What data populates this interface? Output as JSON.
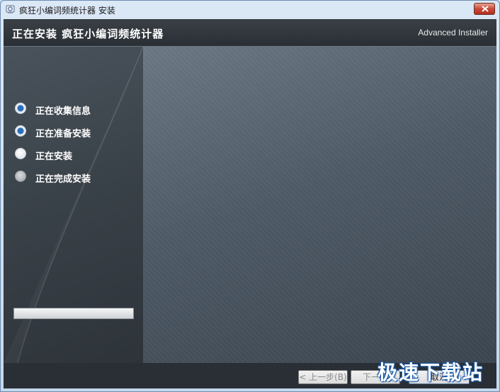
{
  "window": {
    "title": "疯狂小编词频统计器 安装"
  },
  "header": {
    "title": "正在安装 疯狂小编词频统计器",
    "brand": "Advanced Installer"
  },
  "steps": [
    {
      "label": "正在收集信息",
      "state": "done"
    },
    {
      "label": "正在准备安装",
      "state": "done"
    },
    {
      "label": "正在安装",
      "state": "current"
    },
    {
      "label": "正在完成安装",
      "state": "pending"
    }
  ],
  "progress": {
    "value": 0
  },
  "footer": {
    "back_label": "< 上一步(B)",
    "next_label": "下一步",
    "cancel_label": "取消"
  },
  "watermark": {
    "text": "极速下载站"
  },
  "colors": {
    "step_done": "#2a6fb8",
    "close_button": "#c8493a"
  }
}
